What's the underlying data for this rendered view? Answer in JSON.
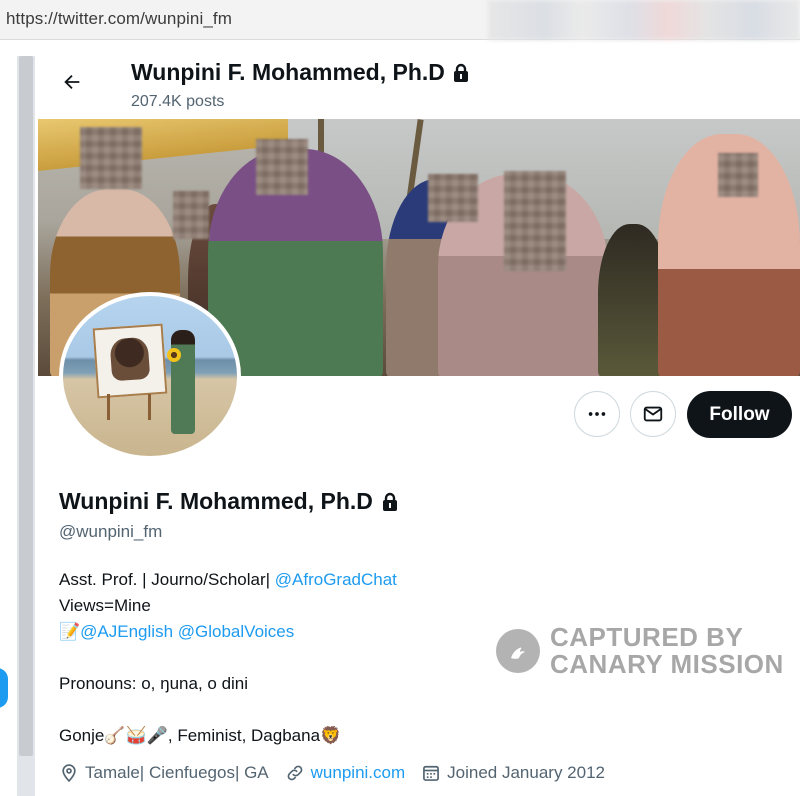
{
  "browser": {
    "url": "https://twitter.com/wunpini_fm"
  },
  "header": {
    "title": "Wunpini F. Mohammed, Ph.D",
    "posts": "207.4K posts"
  },
  "actions": {
    "follow_label": "Follow"
  },
  "profile": {
    "name": "Wunpini F. Mohammed, Ph.D",
    "handle": "@wunpini_fm",
    "bio": {
      "line1_text": "Asst. Prof. | Journo/Scholar| ",
      "line1_link": "@AfroGradChat",
      "line2_text": "Views=Mine",
      "line3_emoji": "📝",
      "line3_link1": "@AJEnglish",
      "line3_link2": "@GlobalVoices",
      "line4_text": "Pronouns: o, ŋuna, o dini",
      "line5_text_start": "Gonje",
      "line5_emoji1": "🪕",
      "line5_emoji2": "🥁",
      "line5_emoji3": "🎤",
      "line5_text_end": ", Feminist, Dagbana",
      "line5_emoji4": "🦁"
    },
    "meta": {
      "location": "Tamale| Cienfuegos| GA",
      "website": "wunpini.com",
      "joined": "Joined January 2012"
    }
  },
  "watermark": {
    "line1": "CAPTURED BY",
    "line2": "CANARY MISSION"
  },
  "colors": {
    "accent": "#1d9bf0",
    "text_primary": "#0f1419",
    "text_secondary": "#536471",
    "follow_bg": "#0f1419"
  }
}
